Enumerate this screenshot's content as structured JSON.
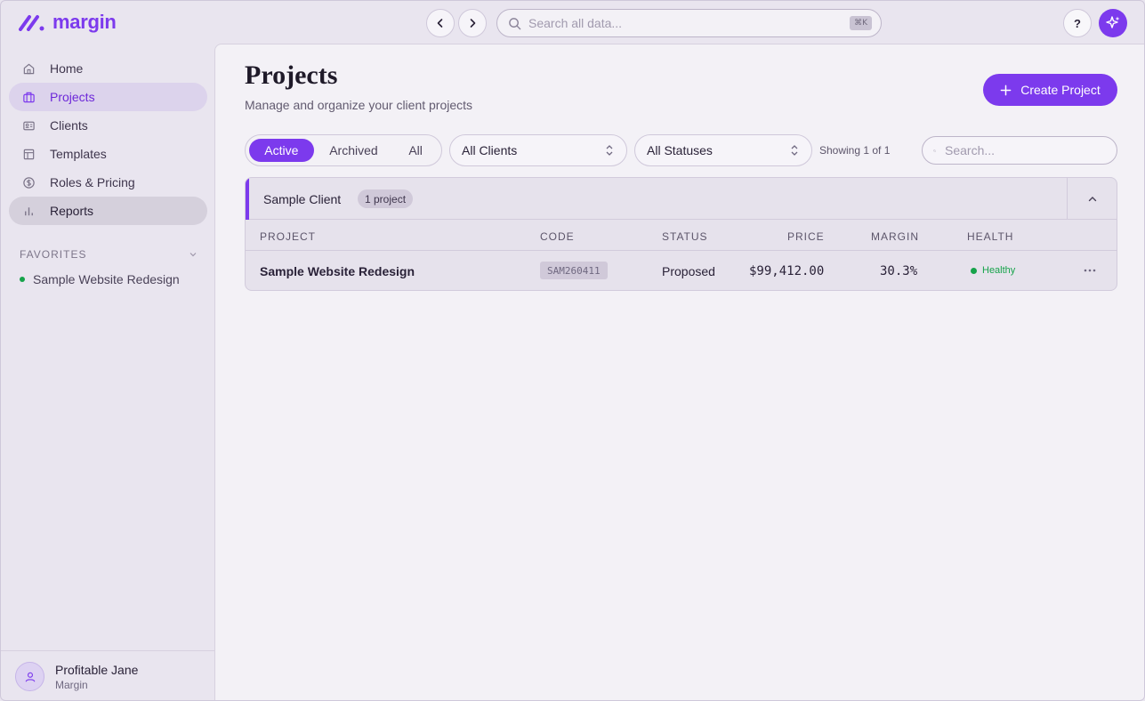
{
  "app": {
    "brand": "margin",
    "brand_color": "#7c3aed"
  },
  "topbar": {
    "search_placeholder": "Search all data...",
    "search_shortcut": "⌘K",
    "help_label": "?"
  },
  "sidebar": {
    "items": [
      {
        "label": "Home",
        "icon": "home-icon"
      },
      {
        "label": "Projects",
        "icon": "briefcase-icon",
        "active": true
      },
      {
        "label": "Clients",
        "icon": "contact-card-icon"
      },
      {
        "label": "Templates",
        "icon": "layout-icon"
      },
      {
        "label": "Roles & Pricing",
        "icon": "dollar-circle-icon"
      },
      {
        "label": "Reports",
        "icon": "bar-chart-icon",
        "hover": true
      }
    ],
    "favorites_heading": "FAVORITES",
    "favorites": [
      {
        "label": "Sample Website Redesign"
      }
    ],
    "user": {
      "name": "Profitable Jane",
      "org": "Margin"
    }
  },
  "main": {
    "title": "Projects",
    "subtitle": "Manage and organize your client projects",
    "create_label": "Create Project",
    "tabs": [
      {
        "label": "Active",
        "selected": true
      },
      {
        "label": "Archived"
      },
      {
        "label": "All"
      }
    ],
    "client_filter": "All Clients",
    "status_filter": "All Statuses",
    "showing": "Showing 1 of 1",
    "search_placeholder": "Search..."
  },
  "group": {
    "client": "Sample Client",
    "count": "1 project",
    "columns": [
      "PROJECT",
      "CODE",
      "STATUS",
      "PRICE",
      "MARGIN",
      "HEALTH"
    ],
    "rows": [
      {
        "project": "Sample Website Redesign",
        "code": "SAM260411",
        "status": "Proposed",
        "price": "$99,412.00",
        "margin": "30.3%",
        "health": "Healthy",
        "health_color": "#16a34a"
      }
    ]
  }
}
